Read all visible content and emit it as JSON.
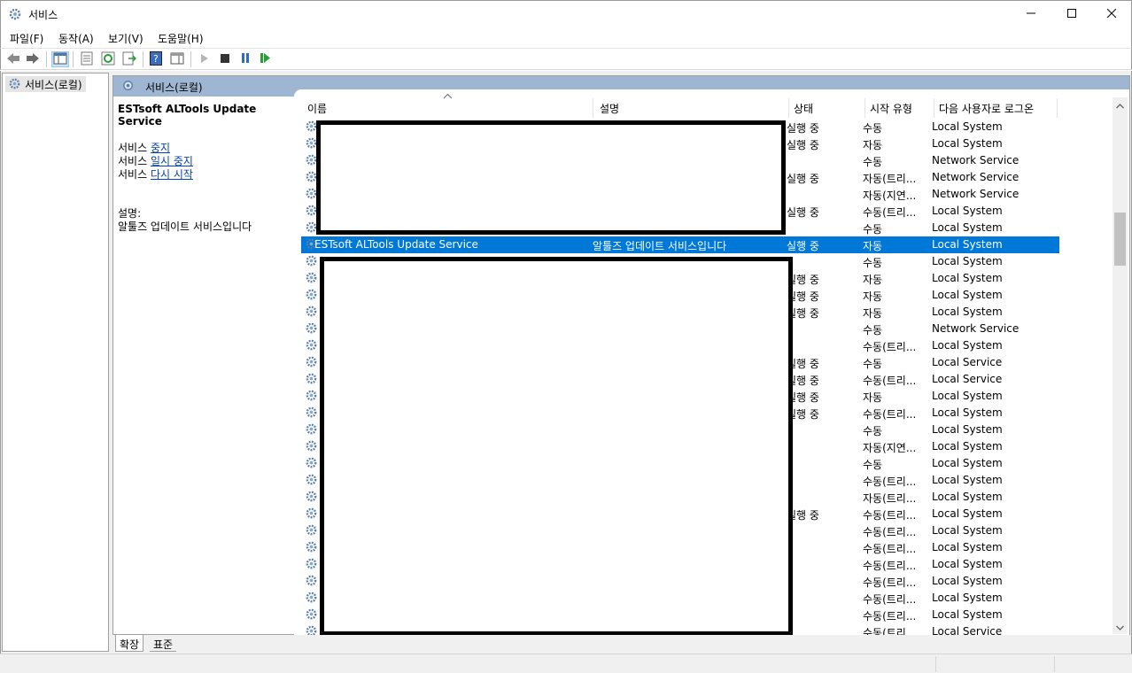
{
  "window": {
    "title": "서비스",
    "minimize_icon": "minimize-icon",
    "maximize_icon": "maximize-icon",
    "close_icon": "close-icon"
  },
  "menu": [
    "파일(F)",
    "동작(A)",
    "보기(V)",
    "도움말(H)"
  ],
  "tree": {
    "root_label": "서비스(로컬)"
  },
  "pane": {
    "header": "서비스(로컬)",
    "selected_name": "ESTsoft ALTools Update Service",
    "action_prefix": "서비스 ",
    "actions": [
      "중지",
      "일시 중지",
      "다시 시작"
    ],
    "desc_label": "설명:",
    "desc_text": "알툴즈 업데이트 서비스입니다"
  },
  "columns": {
    "name": "이름",
    "description": "설명",
    "status": "상태",
    "startup": "시작 유형",
    "logon": "다음 사용자로 로그온"
  },
  "rows": [
    {
      "name": "",
      "desc": "",
      "status": "실행 중",
      "startup": "수동",
      "logon": "Local System"
    },
    {
      "name": "",
      "desc": "",
      "status": "실행 중",
      "startup": "자동",
      "logon": "Local System"
    },
    {
      "name": "",
      "desc": "",
      "status": "",
      "startup": "수동",
      "logon": "Network Service"
    },
    {
      "name": "",
      "desc": "",
      "status": "실행 중",
      "startup": "자동(트리...",
      "logon": "Network Service"
    },
    {
      "name": "",
      "desc": "",
      "status": "",
      "startup": "자동(지연...",
      "logon": "Network Service"
    },
    {
      "name": "",
      "desc": "",
      "status": "실행 중",
      "startup": "수동(트리...",
      "logon": "Local System"
    },
    {
      "name": "",
      "desc": "",
      "status": "",
      "startup": "수동",
      "logon": "Local System"
    },
    {
      "name": "ESTsoft ALTools Update Service",
      "desc": "알툴즈 업데이트 서비스입니다",
      "status": "실행 중",
      "startup": "자동",
      "logon": "Local System",
      "selected": true
    },
    {
      "name": "",
      "desc": "",
      "status": "",
      "startup": "수동",
      "logon": "Local System"
    },
    {
      "name": "",
      "desc": "",
      "status": "실행 중",
      "startup": "자동",
      "logon": "Local System"
    },
    {
      "name": "",
      "desc": "",
      "status": "실행 중",
      "startup": "자동",
      "logon": "Local System"
    },
    {
      "name": "",
      "desc": "",
      "status": "실행 중",
      "startup": "자동",
      "logon": "Local System"
    },
    {
      "name": "",
      "desc": "",
      "status": "",
      "startup": "수동",
      "logon": "Network Service"
    },
    {
      "name": "",
      "desc": "",
      "status": "",
      "startup": "수동(트리...",
      "logon": "Local System"
    },
    {
      "name": "",
      "desc": "",
      "status": "실행 중",
      "startup": "수동",
      "logon": "Local Service"
    },
    {
      "name": "",
      "desc": "",
      "status": "실행 중",
      "startup": "수동(트리...",
      "logon": "Local Service"
    },
    {
      "name": "",
      "desc": "",
      "status": "실행 중",
      "startup": "자동",
      "logon": "Local System"
    },
    {
      "name": "",
      "desc": "",
      "status": "실행 중",
      "startup": "수동(트리...",
      "logon": "Local System"
    },
    {
      "name": "",
      "desc": "",
      "status": "",
      "startup": "수동",
      "logon": "Local System"
    },
    {
      "name": "",
      "desc": "",
      "status": "",
      "startup": "자동(지연...",
      "logon": "Local System"
    },
    {
      "name": "",
      "desc": "",
      "status": "",
      "startup": "수동",
      "logon": "Local System"
    },
    {
      "name": "",
      "desc": "",
      "status": "",
      "startup": "수동(트리...",
      "logon": "Local System"
    },
    {
      "name": "",
      "desc": "",
      "status": "",
      "startup": "자동(트리...",
      "logon": "Local System"
    },
    {
      "name": "",
      "desc": "",
      "status": "실행 중",
      "startup": "수동(트리...",
      "logon": "Local System"
    },
    {
      "name": "",
      "desc": "",
      "status": "",
      "startup": "수동(트리...",
      "logon": "Local System"
    },
    {
      "name": "",
      "desc": "",
      "status": "",
      "startup": "수동(트리...",
      "logon": "Local System"
    },
    {
      "name": "",
      "desc": "",
      "status": "",
      "startup": "수동(트리...",
      "logon": "Local System"
    },
    {
      "name": "",
      "desc": "",
      "status": "",
      "startup": "수동(트리...",
      "logon": "Local System"
    },
    {
      "name": "",
      "desc": "",
      "status": "",
      "startup": "수동(트리...",
      "logon": "Local System"
    },
    {
      "name": "",
      "desc": "",
      "status": "",
      "startup": "수동(트리...",
      "logon": "Local System"
    },
    {
      "name": "",
      "desc": "",
      "status": "",
      "startup": "수동(트리...",
      "logon": "Local Service"
    }
  ],
  "tabs": [
    "확장",
    "표준"
  ],
  "colors": {
    "selection": "#0078d7",
    "header_band": "#9fb6d3",
    "link": "#0645ad"
  }
}
